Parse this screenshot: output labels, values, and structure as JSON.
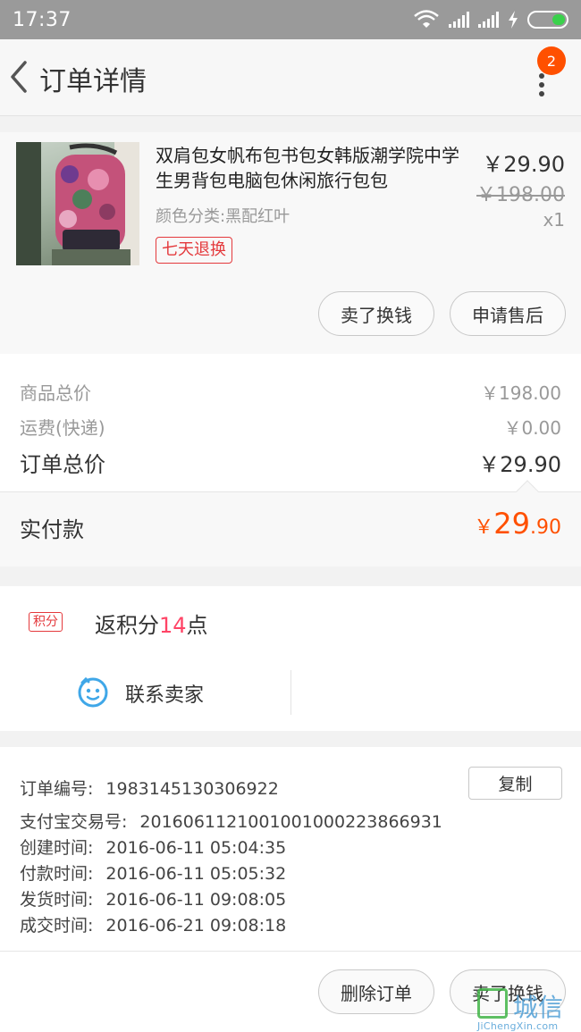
{
  "status_bar": {
    "time": "17:37"
  },
  "header": {
    "title": "订单详情",
    "badge_count": "2"
  },
  "product": {
    "title": "双肩包女帆布包书包女韩版潮学院中学生男背包电脑包休闲旅行包包",
    "sku": "颜色分类:黑配红叶",
    "tag": "七天退换",
    "price_now": "￥29.90",
    "price_original": "￥198.00",
    "quantity": "x1",
    "button_resell": "卖了换钱",
    "button_after_sale": "申请售后"
  },
  "summary": {
    "items_total_label": "商品总价",
    "items_total_value": "￥198.00",
    "shipping_label": "运费(快递)",
    "shipping_value": "￥0.00",
    "order_total_label": "订单总价",
    "order_total_value": "￥29.90",
    "paid_label": "实付款",
    "paid_currency": "￥",
    "paid_integer": "29",
    "paid_decimal": ".90"
  },
  "points": {
    "tag": "积分",
    "prefix": "返积分",
    "number": "14",
    "suffix": "点",
    "contact_seller": "联系卖家"
  },
  "order_info": {
    "copy_button": "复制",
    "rows": [
      {
        "key": "订单编号:",
        "value": "1983145130306922"
      },
      {
        "key": "支付宝交易号:",
        "value": "2016061121001001000223866931"
      },
      {
        "key": "创建时间:",
        "value": "2016-06-11 05:04:35"
      },
      {
        "key": "付款时间:",
        "value": "2016-06-11 05:05:32"
      },
      {
        "key": "发货时间:",
        "value": "2016-06-11 09:08:05"
      },
      {
        "key": "成交时间:",
        "value": "2016-06-21 09:08:18"
      }
    ]
  },
  "bottom_bar": {
    "delete_order": "删除订单",
    "resell": "卖了换钱"
  },
  "watermark": {
    "text": "城信",
    "sub": "JiChengXin.com"
  },
  "colors": {
    "accent": "#ff5000",
    "tag_red": "#e4393c",
    "points_pink": "#ff4466",
    "contact_blue": "#3fa7e8"
  }
}
